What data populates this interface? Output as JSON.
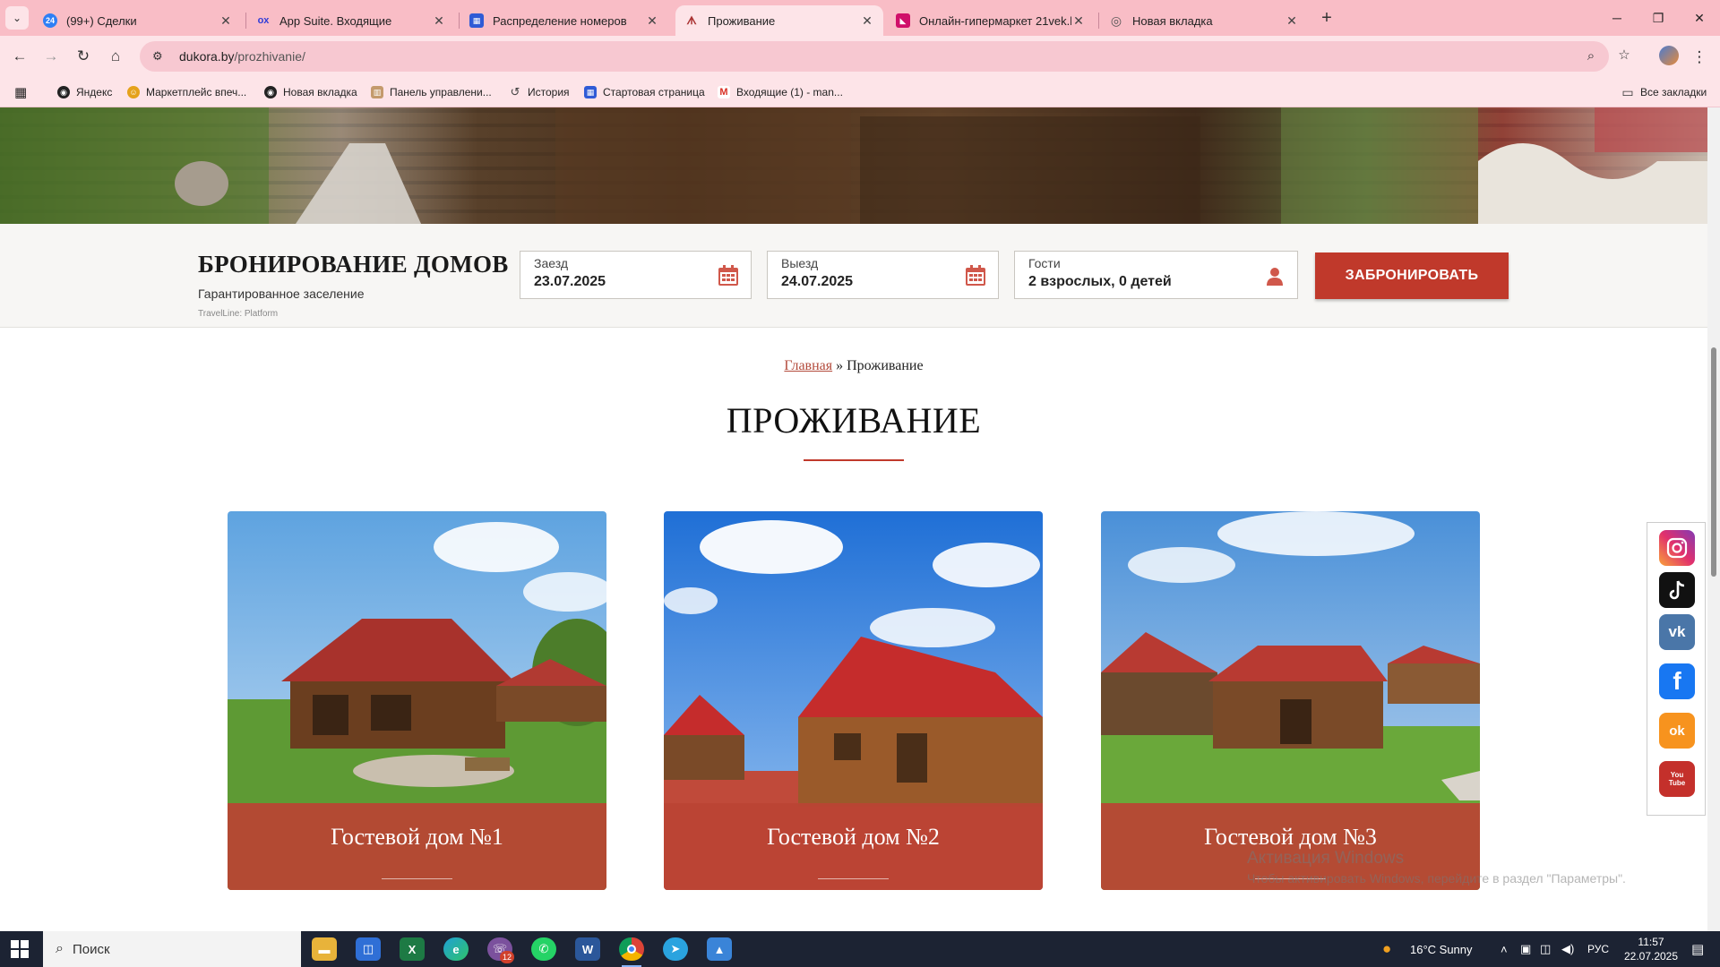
{
  "browser": {
    "tabs": [
      {
        "label": "(99+) Сделки",
        "favicon_color": "#2f7ff5",
        "favicon_text": "24"
      },
      {
        "label": "App Suite. Входящие",
        "favicon_color": "#2f3cd8",
        "favicon_text": "ox"
      },
      {
        "label": "Распределение номеров",
        "favicon_color": "#2f5bd6",
        "favicon_text": "▦"
      },
      {
        "label": "Проживание",
        "favicon_color": "#a33",
        "favicon_text": "ᗑ"
      },
      {
        "label": "Онлайн-гипермаркет 21vek.by",
        "favicon_color": "#d0106a",
        "favicon_text": "◣"
      },
      {
        "label": "Новая вкладка",
        "favicon_color": "#666",
        "favicon_text": "◎"
      }
    ],
    "close_glyph": "✕",
    "new_tab_glyph": "+",
    "url_host": "dukora.by",
    "url_path": "/prozhivanie/",
    "bookmarks": [
      {
        "label": "Яндекс",
        "color": "#222",
        "glyph": "◉"
      },
      {
        "label": "Маркетплейс впеч...",
        "color": "#e5a21b",
        "glyph": "☺"
      },
      {
        "label": "Новая вкладка",
        "color": "#222",
        "glyph": "◉"
      },
      {
        "label": "Панель управлени...",
        "color": "#c49a6c",
        "glyph": "▥"
      },
      {
        "label": "История",
        "color": "#444",
        "glyph": "↺"
      },
      {
        "label": "Стартовая страница",
        "color": "#2f5bd6",
        "glyph": "▦"
      },
      {
        "label": "Входящие (1) - man...",
        "color": "#d93025",
        "glyph": "M"
      }
    ],
    "all_bookmarks": "Все закладки"
  },
  "booking": {
    "title": "БРОНИРОВАНИЕ ДОМОВ",
    "subtitle": "Гарантированное заселение",
    "provider": "TravelLine: Platform",
    "checkin_label": "Заезд",
    "checkin_value": "23.07.2025",
    "checkout_label": "Выезд",
    "checkout_value": "24.07.2025",
    "guests_label": "Гости",
    "guests_value": "2 взрослых, 0 детей",
    "button": "ЗАБРОНИРОВАТЬ",
    "accent": "#c0392b"
  },
  "breadcrumb": {
    "home": "Главная",
    "separator": "»",
    "current": "Проживание"
  },
  "page_title": "ПРОЖИВАНИЕ",
  "cards": [
    {
      "title": "Гостевой дом №1"
    },
    {
      "title": "Гостевой дом №2"
    },
    {
      "title": "Гостевой дом №3"
    }
  ],
  "social": [
    {
      "name": "instagram-icon"
    },
    {
      "name": "tiktok-icon"
    },
    {
      "name": "vk-icon",
      "glyph": "vk"
    },
    {
      "name": "facebook-icon",
      "glyph": "f"
    },
    {
      "name": "odnoklassniki-icon",
      "glyph": "ok"
    },
    {
      "name": "youtube-icon",
      "glyph": "You Tube"
    }
  ],
  "watermark": {
    "line1": "Активация Windows",
    "line2": "Чтобы активировать Windows, перейдите в раздел \"Параметры\"."
  },
  "taskbar": {
    "search_placeholder": "Поиск",
    "weather": "16°C  Sunny",
    "lang": "РУС",
    "time": "11:57",
    "date": "22.07.2025",
    "viber_badge": "12"
  }
}
